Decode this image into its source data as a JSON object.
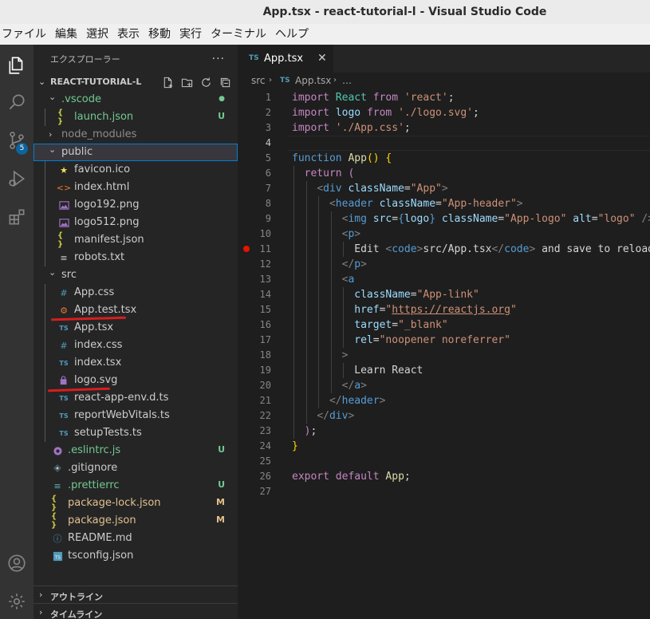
{
  "window": {
    "title": "App.tsx - react-tutorial-l - Visual Studio Code"
  },
  "menu": [
    "ファイル",
    "編集",
    "選択",
    "表示",
    "移動",
    "実行",
    "ターミナル",
    "ヘルプ"
  ],
  "activity_bar": {
    "items": [
      "files-icon",
      "search-icon",
      "source-control-icon",
      "run-debug-icon",
      "extensions-icon"
    ],
    "badge": "5",
    "bottom": [
      "account-icon",
      "settings-gear-icon"
    ]
  },
  "sidebar": {
    "header": "エクスプローラー",
    "more": "···",
    "project": "REACT-TUTORIAL-L",
    "tree": [
      {
        "name": ".vscode",
        "type": "folder",
        "open": true,
        "depth": 0,
        "color": "#73c991",
        "status": "●",
        "status_color": "#73c991"
      },
      {
        "name": "launch.json",
        "type": "json",
        "depth": 1,
        "color": "#73c991",
        "status": "U",
        "status_color": "#73c991"
      },
      {
        "name": "node_modules",
        "type": "folder",
        "open": false,
        "depth": 0,
        "color": "#8c8c8c"
      },
      {
        "name": "public",
        "type": "folder",
        "open": true,
        "depth": 0,
        "color": "#cccccc",
        "selected": true
      },
      {
        "name": "favicon.ico",
        "type": "star",
        "depth": 1,
        "color": "#cccccc"
      },
      {
        "name": "index.html",
        "type": "html",
        "depth": 1,
        "color": "#cccccc"
      },
      {
        "name": "logo192.png",
        "type": "image",
        "depth": 1,
        "color": "#cccccc"
      },
      {
        "name": "logo512.png",
        "type": "image",
        "depth": 1,
        "color": "#cccccc"
      },
      {
        "name": "manifest.json",
        "type": "json",
        "depth": 1,
        "color": "#cccccc"
      },
      {
        "name": "robots.txt",
        "type": "text",
        "depth": 1,
        "color": "#cccccc"
      },
      {
        "name": "src",
        "type": "folder",
        "open": true,
        "depth": 0,
        "color": "#cccccc"
      },
      {
        "name": "App.css",
        "type": "css",
        "depth": 1,
        "color": "#cccccc"
      },
      {
        "name": "App.test.tsx",
        "type": "test",
        "depth": 1,
        "color": "#cccccc"
      },
      {
        "name": "App.tsx",
        "type": "ts",
        "depth": 1,
        "color": "#cccccc"
      },
      {
        "name": "index.css",
        "type": "css",
        "depth": 1,
        "color": "#cccccc"
      },
      {
        "name": "index.tsx",
        "type": "ts",
        "depth": 1,
        "color": "#cccccc"
      },
      {
        "name": "logo.svg",
        "type": "svg",
        "depth": 1,
        "color": "#cccccc"
      },
      {
        "name": "react-app-env.d.ts",
        "type": "ts",
        "depth": 1,
        "color": "#cccccc"
      },
      {
        "name": "reportWebVitals.ts",
        "type": "ts",
        "depth": 1,
        "color": "#cccccc"
      },
      {
        "name": "setupTests.ts",
        "type": "ts",
        "depth": 1,
        "color": "#cccccc"
      },
      {
        "name": ".eslintrc.js",
        "type": "eslint",
        "depth": 0,
        "color": "#73c991",
        "status": "U",
        "status_color": "#73c991"
      },
      {
        "name": ".gitignore",
        "type": "git",
        "depth": 0,
        "color": "#cccccc"
      },
      {
        "name": ".prettierrc",
        "type": "prettier",
        "depth": 0,
        "color": "#73c991",
        "status": "U",
        "status_color": "#73c991"
      },
      {
        "name": "package-lock.json",
        "type": "json",
        "depth": 0,
        "color": "#e2c08d",
        "status": "M",
        "status_color": "#e2c08d"
      },
      {
        "name": "package.json",
        "type": "json",
        "depth": 0,
        "color": "#e2c08d",
        "status": "M",
        "status_color": "#e2c08d"
      },
      {
        "name": "README.md",
        "type": "info",
        "depth": 0,
        "color": "#cccccc"
      },
      {
        "name": "tsconfig.json",
        "type": "tsconfig",
        "depth": 0,
        "color": "#cccccc"
      }
    ],
    "outline": "アウトライン",
    "timeline": "タイムライン"
  },
  "editor": {
    "tab": {
      "badge": "TS",
      "name": "App.tsx",
      "close": "✕"
    },
    "breadcrumbs": {
      "folder": "src",
      "badge": "TS",
      "file": "App.tsx",
      "more": "…"
    },
    "breakpoint_line": 11,
    "current_line": 4,
    "lines": [
      [
        [
          "c",
          "import"
        ],
        [
          "p",
          " "
        ],
        [
          "t",
          "React"
        ],
        [
          "p",
          " "
        ],
        [
          "c",
          "from"
        ],
        [
          "p",
          " "
        ],
        [
          "s",
          "'react'"
        ],
        [
          "p",
          ";"
        ]
      ],
      [
        [
          "c",
          "import"
        ],
        [
          "p",
          " "
        ],
        [
          "v",
          "logo"
        ],
        [
          "p",
          " "
        ],
        [
          "c",
          "from"
        ],
        [
          "p",
          " "
        ],
        [
          "s",
          "'./logo.svg'"
        ],
        [
          "p",
          ";"
        ]
      ],
      [
        [
          "c",
          "import"
        ],
        [
          "p",
          " "
        ],
        [
          "s",
          "'./App.css'"
        ],
        [
          "p",
          ";"
        ]
      ],
      [],
      [
        [
          "k",
          "function"
        ],
        [
          "p",
          " "
        ],
        [
          "f",
          "App"
        ],
        [
          "y",
          "()"
        ],
        [
          "p",
          " "
        ],
        [
          "y",
          "{"
        ]
      ],
      [
        [
          "p",
          "  "
        ],
        [
          "c",
          "return"
        ],
        [
          "p",
          " "
        ],
        [
          "c",
          "("
        ]
      ],
      [
        [
          "p",
          "    "
        ],
        [
          "g",
          "<"
        ],
        [
          "tg",
          "div"
        ],
        [
          "p",
          " "
        ],
        [
          "v",
          "className"
        ],
        [
          "p",
          "="
        ],
        [
          "s",
          "\"App\""
        ],
        [
          "g",
          ">"
        ]
      ],
      [
        [
          "p",
          "      "
        ],
        [
          "g",
          "<"
        ],
        [
          "tg",
          "header"
        ],
        [
          "p",
          " "
        ],
        [
          "v",
          "className"
        ],
        [
          "p",
          "="
        ],
        [
          "s",
          "\"App-header\""
        ],
        [
          "g",
          ">"
        ]
      ],
      [
        [
          "p",
          "        "
        ],
        [
          "g",
          "<"
        ],
        [
          "tg",
          "img"
        ],
        [
          "p",
          " "
        ],
        [
          "v",
          "src"
        ],
        [
          "p",
          "="
        ],
        [
          "k",
          "{"
        ],
        [
          "v",
          "logo"
        ],
        [
          "k",
          "}"
        ],
        [
          "p",
          " "
        ],
        [
          "v",
          "className"
        ],
        [
          "p",
          "="
        ],
        [
          "s",
          "\"App-logo\""
        ],
        [
          "p",
          " "
        ],
        [
          "v",
          "alt"
        ],
        [
          "p",
          "="
        ],
        [
          "s",
          "\"logo\""
        ],
        [
          "p",
          " "
        ],
        [
          "g",
          "/>"
        ]
      ],
      [
        [
          "p",
          "        "
        ],
        [
          "g",
          "<"
        ],
        [
          "tg",
          "p"
        ],
        [
          "g",
          ">"
        ]
      ],
      [
        [
          "p",
          "          Edit "
        ],
        [
          "g",
          "<"
        ],
        [
          "tg",
          "code"
        ],
        [
          "g",
          ">"
        ],
        [
          "p",
          "src/App.tsx"
        ],
        [
          "g",
          "</"
        ],
        [
          "tg",
          "code"
        ],
        [
          "g",
          ">"
        ],
        [
          "p",
          " and save to reload."
        ]
      ],
      [
        [
          "p",
          "        "
        ],
        [
          "g",
          "</"
        ],
        [
          "tg",
          "p"
        ],
        [
          "g",
          ">"
        ]
      ],
      [
        [
          "p",
          "        "
        ],
        [
          "g",
          "<"
        ],
        [
          "tg",
          "a"
        ]
      ],
      [
        [
          "p",
          "          "
        ],
        [
          "v",
          "className"
        ],
        [
          "p",
          "="
        ],
        [
          "s",
          "\"App-link\""
        ]
      ],
      [
        [
          "p",
          "          "
        ],
        [
          "v",
          "href"
        ],
        [
          "p",
          "="
        ],
        [
          "s",
          "\""
        ],
        [
          "su",
          "https://reactjs.org"
        ],
        [
          "s",
          "\""
        ]
      ],
      [
        [
          "p",
          "          "
        ],
        [
          "v",
          "target"
        ],
        [
          "p",
          "="
        ],
        [
          "s",
          "\"_blank\""
        ]
      ],
      [
        [
          "p",
          "          "
        ],
        [
          "v",
          "rel"
        ],
        [
          "p",
          "="
        ],
        [
          "s",
          "\"noopener noreferrer\""
        ]
      ],
      [
        [
          "p",
          "        "
        ],
        [
          "g",
          ">"
        ]
      ],
      [
        [
          "p",
          "          Learn React"
        ]
      ],
      [
        [
          "p",
          "        "
        ],
        [
          "g",
          "</"
        ],
        [
          "tg",
          "a"
        ],
        [
          "g",
          ">"
        ]
      ],
      [
        [
          "p",
          "      "
        ],
        [
          "g",
          "</"
        ],
        [
          "tg",
          "header"
        ],
        [
          "g",
          ">"
        ]
      ],
      [
        [
          "p",
          "    "
        ],
        [
          "g",
          "</"
        ],
        [
          "tg",
          "div"
        ],
        [
          "g",
          ">"
        ]
      ],
      [
        [
          "p",
          "  "
        ],
        [
          "c",
          ")"
        ],
        [
          "p",
          ";"
        ]
      ],
      [
        [
          "y",
          "}"
        ]
      ],
      [],
      [
        [
          "c",
          "export"
        ],
        [
          "p",
          " "
        ],
        [
          "c",
          "default"
        ],
        [
          "p",
          " "
        ],
        [
          "f",
          "App"
        ],
        [
          "p",
          ";"
        ]
      ],
      []
    ]
  },
  "annotations": {
    "underline_color": "#d81e1e",
    "underlined_files": [
      "App.test.tsx",
      "logo.svg"
    ]
  }
}
